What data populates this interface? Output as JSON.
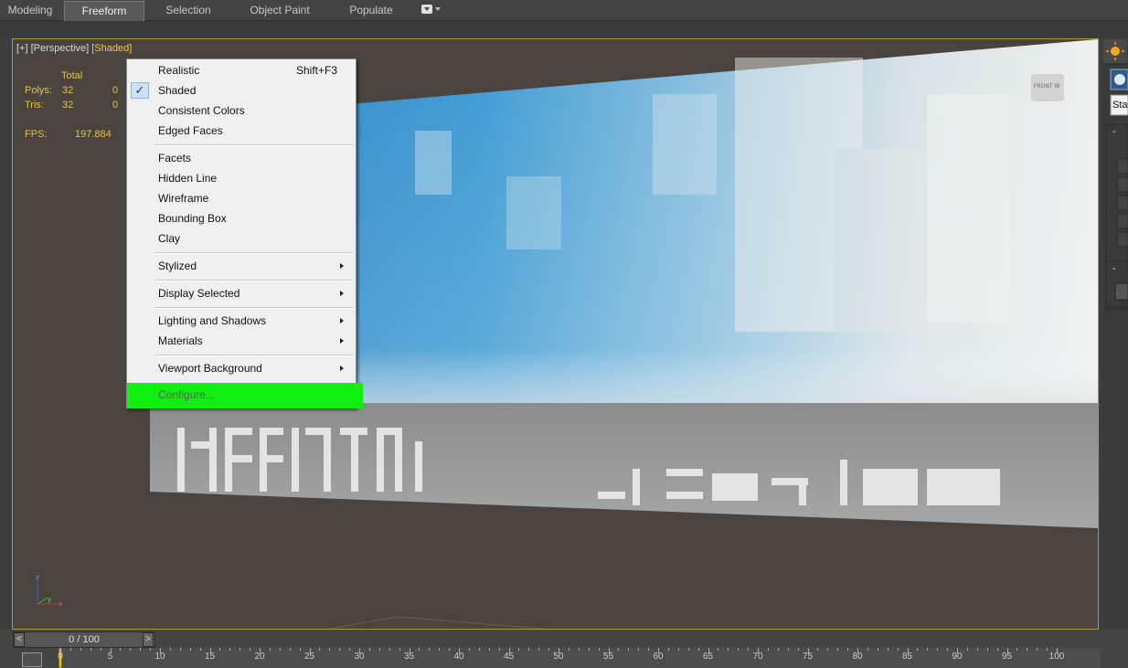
{
  "ribbon": {
    "tabs": [
      {
        "label": "Modeling",
        "active": false
      },
      {
        "label": "Freeform",
        "active": true
      },
      {
        "label": "Selection",
        "active": false
      },
      {
        "label": "Object Paint",
        "active": false
      },
      {
        "label": "Populate",
        "active": false
      }
    ]
  },
  "viewport": {
    "label_plus": "[+]",
    "label_view": "[Perspective]",
    "label_shading": "[Shaded]",
    "stats": {
      "header": "Total",
      "polys_label": "Polys:",
      "polys_total": "32",
      "polys_sel": "0",
      "tris_label": "Tris:",
      "tris_total": "32",
      "tris_sel": "0",
      "fps_label": "FPS:",
      "fps_value": "197.884"
    },
    "viewcube_label": "FRONT W",
    "axis": {
      "z": "z",
      "x": "x",
      "y": "y"
    }
  },
  "context_menu": {
    "realistic": "Realistic",
    "realistic_shortcut": "Shift+F3",
    "shaded": "Shaded",
    "shaded_checked": true,
    "check_glyph": "✓",
    "consistent_colors": "Consistent Colors",
    "edged_faces": "Edged Faces",
    "facets": "Facets",
    "hidden_line": "Hidden Line",
    "wireframe": "Wireframe",
    "bounding_box": "Bounding Box",
    "clay": "Clay",
    "stylized": "Stylized",
    "display_selected": "Display Selected",
    "lighting_and_shadows": "Lighting and Shadows",
    "materials": "Materials",
    "viewport_background": "Viewport Background",
    "configure": "Configure...",
    "configure_highlight_color": "#10f010"
  },
  "command_panel": {
    "rollout_minus_1": "-",
    "rollout_minus_2": "-",
    "field_text": "Sta"
  },
  "timeline": {
    "frame_label": "0 / 100",
    "prev": "<",
    "next": ">",
    "ticks": [
      "0",
      "5",
      "10",
      "15",
      "20",
      "25",
      "30",
      "35",
      "40",
      "45",
      "50",
      "55",
      "60",
      "65",
      "70",
      "75",
      "80",
      "85",
      "90",
      "95",
      "100"
    ]
  },
  "colors": {
    "viewport_border": "#b5962b",
    "stats_text": "#e8c33f",
    "shading_label": "#f3c545"
  }
}
